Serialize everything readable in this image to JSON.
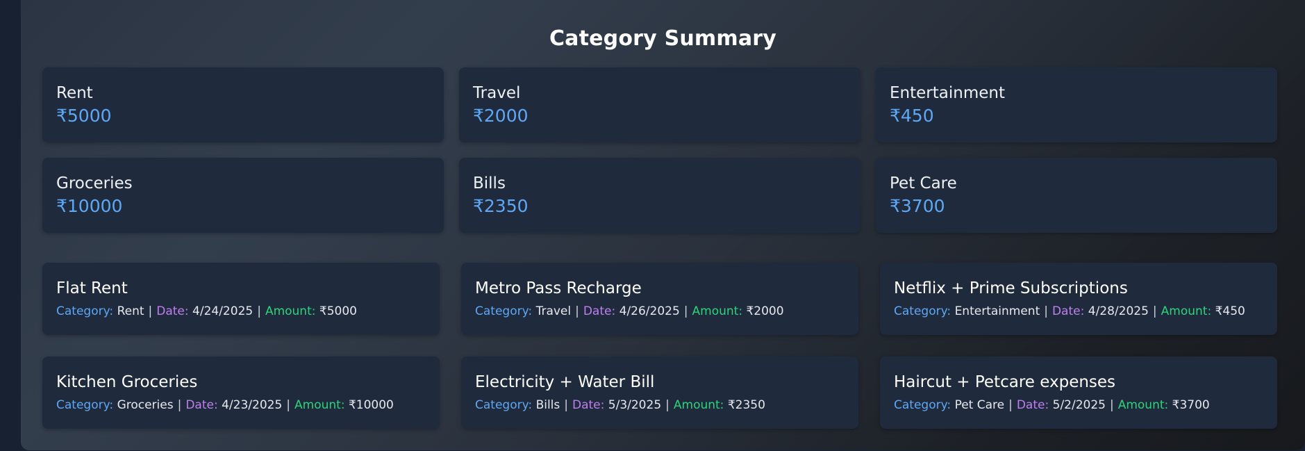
{
  "title": "Category Summary",
  "labels": {
    "category": "Category:",
    "date": "Date:",
    "amount": "Amount:",
    "separator": "|"
  },
  "summary": [
    {
      "name": "Rent",
      "amount": "₹5000"
    },
    {
      "name": "Travel",
      "amount": "₹2000"
    },
    {
      "name": "Entertainment",
      "amount": "₹450"
    },
    {
      "name": "Groceries",
      "amount": "₹10000"
    },
    {
      "name": "Bills",
      "amount": "₹2350"
    },
    {
      "name": "Pet Care",
      "amount": "₹3700"
    }
  ],
  "expenses": [
    {
      "title": "Flat Rent",
      "category": "Rent",
      "date": "4/24/2025",
      "amount": "₹5000"
    },
    {
      "title": "Metro Pass Recharge",
      "category": "Travel",
      "date": "4/26/2025",
      "amount": "₹2000"
    },
    {
      "title": "Netflix + Prime Subscriptions",
      "category": "Entertainment",
      "date": "4/28/2025",
      "amount": "₹450"
    },
    {
      "title": "Kitchen Groceries",
      "category": "Groceries",
      "date": "4/23/2025",
      "amount": "₹10000"
    },
    {
      "title": "Electricity + Water Bill",
      "category": "Bills",
      "date": "5/3/2025",
      "amount": "₹2350"
    },
    {
      "title": "Haircut + Petcare expenses",
      "category": "Pet Care",
      "date": "5/2/2025",
      "amount": "₹3700"
    }
  ],
  "colors": {
    "category_label": "#5ea8f5",
    "date_label": "#c07ff0",
    "amount_label": "#2ed47a",
    "card_bg": "#1f2a3c"
  }
}
